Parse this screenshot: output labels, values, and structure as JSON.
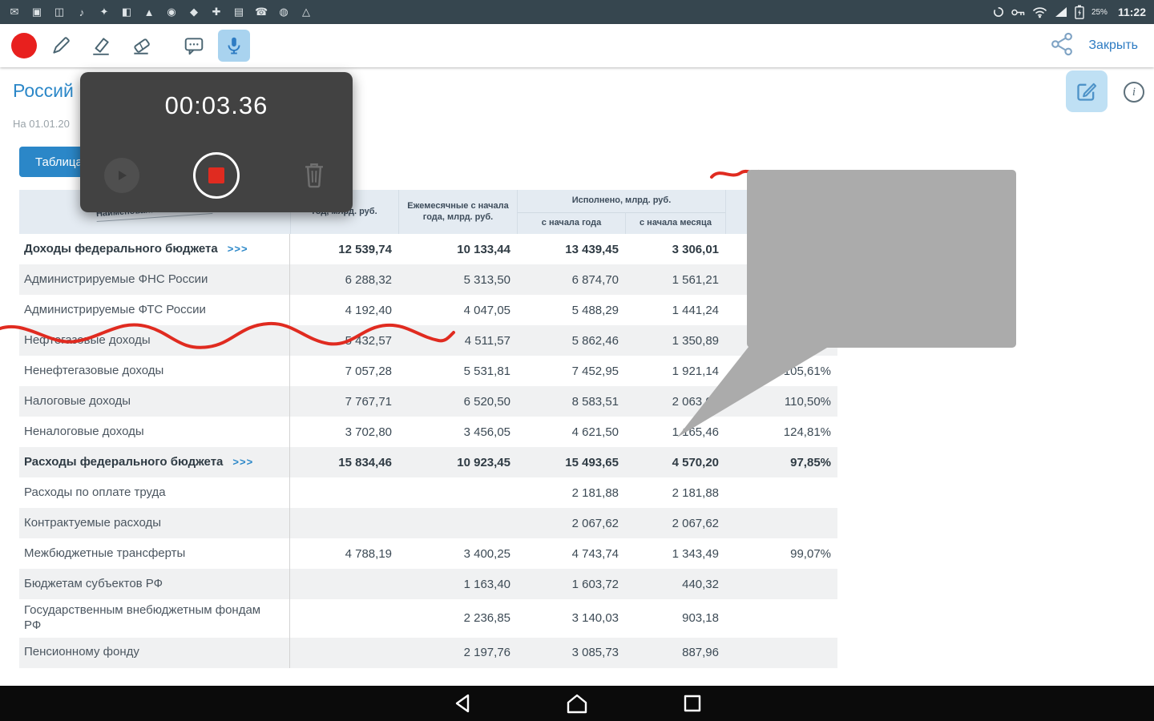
{
  "colors": {
    "accent_blue": "#2b87c8",
    "record_red": "#e8201e",
    "annotation_red": "#e02b20",
    "bubble_gray": "#ababab",
    "status_bar_bg": "#36464f",
    "header_bg": "#e4ebf2"
  },
  "status_bar": {
    "time": "11:22",
    "battery_percent": "25%",
    "left_icons": [
      {
        "name": "message-icon",
        "glyph": "✉"
      },
      {
        "name": "screenshot-icon",
        "glyph": "▣"
      },
      {
        "name": "sd-card-icon",
        "glyph": "◫"
      },
      {
        "name": "music-icon",
        "glyph": "♪"
      },
      {
        "name": "star-icon",
        "glyph": "✦"
      },
      {
        "name": "display-icon",
        "glyph": "◧"
      },
      {
        "name": "download-icon",
        "glyph": "▲"
      },
      {
        "name": "record-icon",
        "glyph": "◉"
      },
      {
        "name": "diamond-icon",
        "glyph": "◆"
      },
      {
        "name": "plus-icon",
        "glyph": "✚"
      },
      {
        "name": "layers-icon",
        "glyph": "▤"
      },
      {
        "name": "phone-icon",
        "glyph": "☎"
      },
      {
        "name": "dot-icon",
        "glyph": "◍"
      },
      {
        "name": "warning-icon",
        "glyph": "△"
      }
    ]
  },
  "toolbar": {
    "close_label": "Закрыть"
  },
  "recorder": {
    "timer": "00:03.36"
  },
  "page": {
    "title": "Россий",
    "date_label": "На 01.01.20",
    "table_button_label": "Таблица"
  },
  "table": {
    "col_headers": {
      "name": "Наименование показателя",
      "year": "год, млрд. руб.",
      "monthly": "Ежемесячные с начала года, млрд. руб.",
      "executed_group": "Исполнено, млрд. руб.",
      "executed_ytd": "с начала года",
      "executed_mtd": "с начала месяца",
      "percent": ""
    },
    "rows": [
      {
        "name": "Доходы федерального бюджета",
        "bold": true,
        "link": ">>>",
        "values": [
          "12 539,74",
          "10 133,44",
          "13 439,45",
          "3 306,01",
          ""
        ]
      },
      {
        "name": "Администрируемые ФНС России",
        "values": [
          "6 288,32",
          "5 313,50",
          "6 874,70",
          "1 561,21",
          ""
        ]
      },
      {
        "name": "Администрируемые ФТС России",
        "values": [
          "4 192,40",
          "4 047,05",
          "5 488,29",
          "1 441,24",
          ""
        ]
      },
      {
        "name": "Нефтегазовые доходы",
        "values": [
          "5 432,57",
          "4 511,57",
          "5 862,46",
          "1 350,89",
          ""
        ]
      },
      {
        "name": "Ненефтегазовые доходы",
        "values": [
          "7 057,28",
          "5 531,81",
          "7 452,95",
          "1 921,14",
          "105,61%"
        ]
      },
      {
        "name": "Налоговые доходы",
        "values": [
          "7 767,71",
          "6 520,50",
          "8 583,51",
          "2 063,01",
          "110,50%"
        ]
      },
      {
        "name": "Неналоговые доходы",
        "values": [
          "3 702,80",
          "3 456,05",
          "4 621,50",
          "1 165,46",
          "124,81%"
        ]
      },
      {
        "name": "Расходы федерального бюджета",
        "bold": true,
        "link": ">>>",
        "values": [
          "15 834,46",
          "10 923,45",
          "15 493,65",
          "4 570,20",
          "97,85%"
        ]
      },
      {
        "name": "Расходы по оплате труда",
        "values": [
          "",
          "",
          "2 181,88",
          "2 181,88",
          ""
        ]
      },
      {
        "name": "Контрактуемые расходы",
        "values": [
          "",
          "",
          "2 067,62",
          "2 067,62",
          ""
        ]
      },
      {
        "name": "Межбюджетные трансферты",
        "values": [
          "4 788,19",
          "3 400,25",
          "4 743,74",
          "1 343,49",
          "99,07%"
        ]
      },
      {
        "name": "Бюджетам субъектов РФ",
        "values": [
          "",
          "1 163,40",
          "1 603,72",
          "440,32",
          ""
        ]
      },
      {
        "name": "Государственным внебюджетным фондам РФ",
        "values": [
          "",
          "2 236,85",
          "3 140,03",
          "903,18",
          ""
        ]
      },
      {
        "name": "Пенсионному фонду",
        "values": [
          "",
          "2 197,76",
          "3 085,73",
          "887,96",
          ""
        ]
      }
    ]
  }
}
